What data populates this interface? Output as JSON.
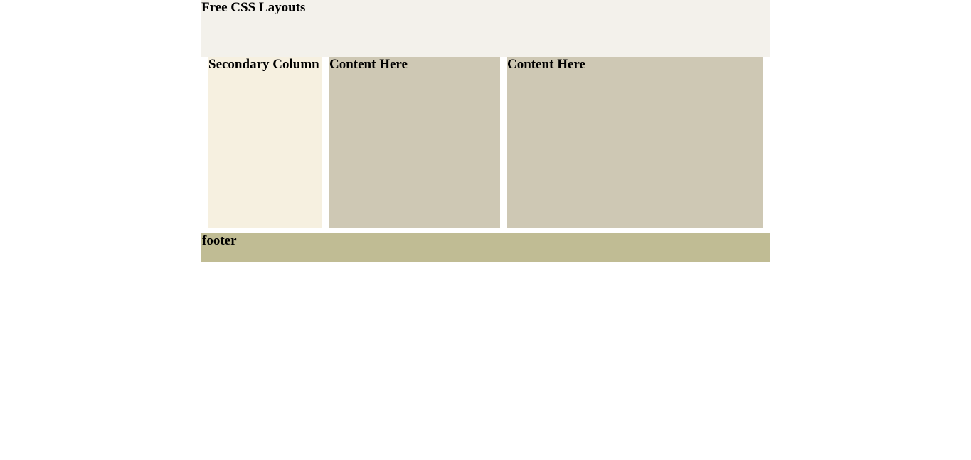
{
  "header": {
    "title": "Free CSS Layouts"
  },
  "columns": {
    "secondary": {
      "title": "Secondary Column"
    },
    "content_1": {
      "title": "Content Here"
    },
    "content_2": {
      "title": "Content Here"
    }
  },
  "footer": {
    "text": "footer"
  },
  "colors": {
    "header_bg": "#f3f1eb",
    "secondary_bg": "#f6f0e0",
    "content_bg": "#cec8b4",
    "footer_bg": "#c0bc94",
    "page_bg": "#ffffff"
  }
}
